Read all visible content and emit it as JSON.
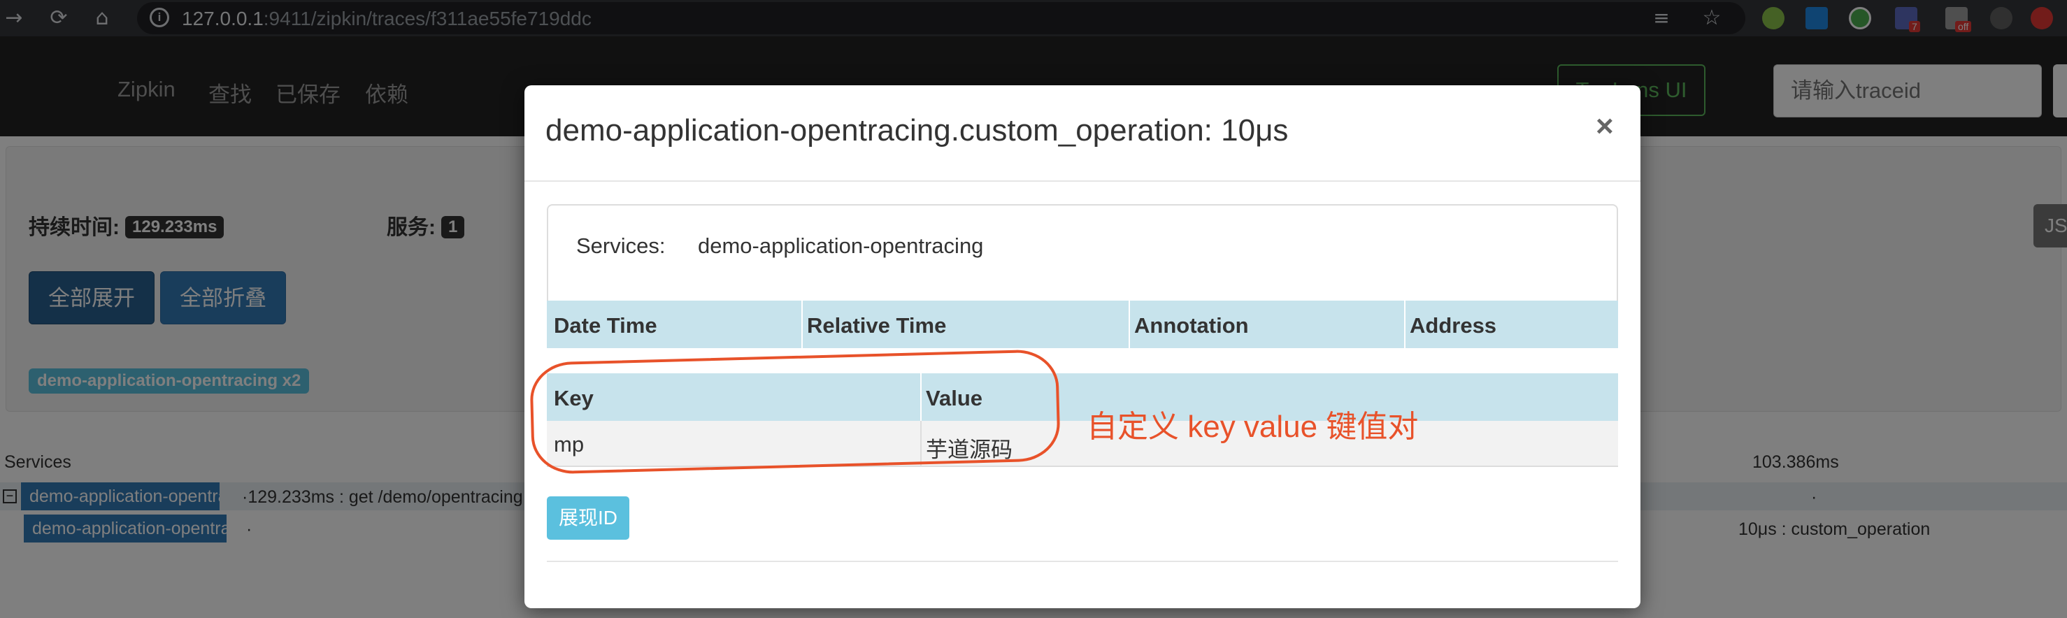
{
  "browser": {
    "url_host": "127.0.0.1",
    "url_rest": ":9411/zipkin/traces/f311ae55fe719ddc",
    "extension_badges": [
      "7",
      "off"
    ]
  },
  "app": {
    "brand": "Zipkin",
    "nav": [
      "查找",
      "已保存",
      "依赖"
    ],
    "lens_button": "Try Lens UI",
    "trace_input_placeholder": "请输入traceid"
  },
  "summary": {
    "duration_label": "持续时间:",
    "duration_value": "129.233ms",
    "services_label": "服务:",
    "services_value": "1",
    "expand_all": "全部展开",
    "collapse_all": "全部折叠",
    "service_badge": "demo-application-opentracing x2",
    "json_button": "JSON"
  },
  "timeline": {
    "services_header": "Services",
    "end_time": "103.386ms",
    "rows": [
      {
        "name": "demo-application-opentracing",
        "detail": "·129.233ms : get /demo/opentracing",
        "right": "·"
      },
      {
        "name": "demo-application-opentracing",
        "detail": "·",
        "right": "10μs : custom_operation"
      }
    ]
  },
  "modal": {
    "title": "demo-application-opentracing.custom_operation: 10μs",
    "close": "×",
    "services_label": "Services:",
    "services_value": "demo-application-opentracing",
    "annotation_headers": [
      "Date Time",
      "Relative Time",
      "Annotation",
      "Address"
    ],
    "kv_headers": [
      "Key",
      "Value"
    ],
    "kv_rows": [
      {
        "key": "mp",
        "value": "芋道源码"
      }
    ],
    "show_id_button": "展现ID"
  },
  "annotation": {
    "text": "自定义 key value 键值对",
    "color": "#e8522a"
  },
  "colors": {
    "header_bg": "#222222",
    "primary": "#337ab7",
    "info": "#5bc0de",
    "success": "#5cb85c",
    "table_head": "#c7e3ec"
  }
}
